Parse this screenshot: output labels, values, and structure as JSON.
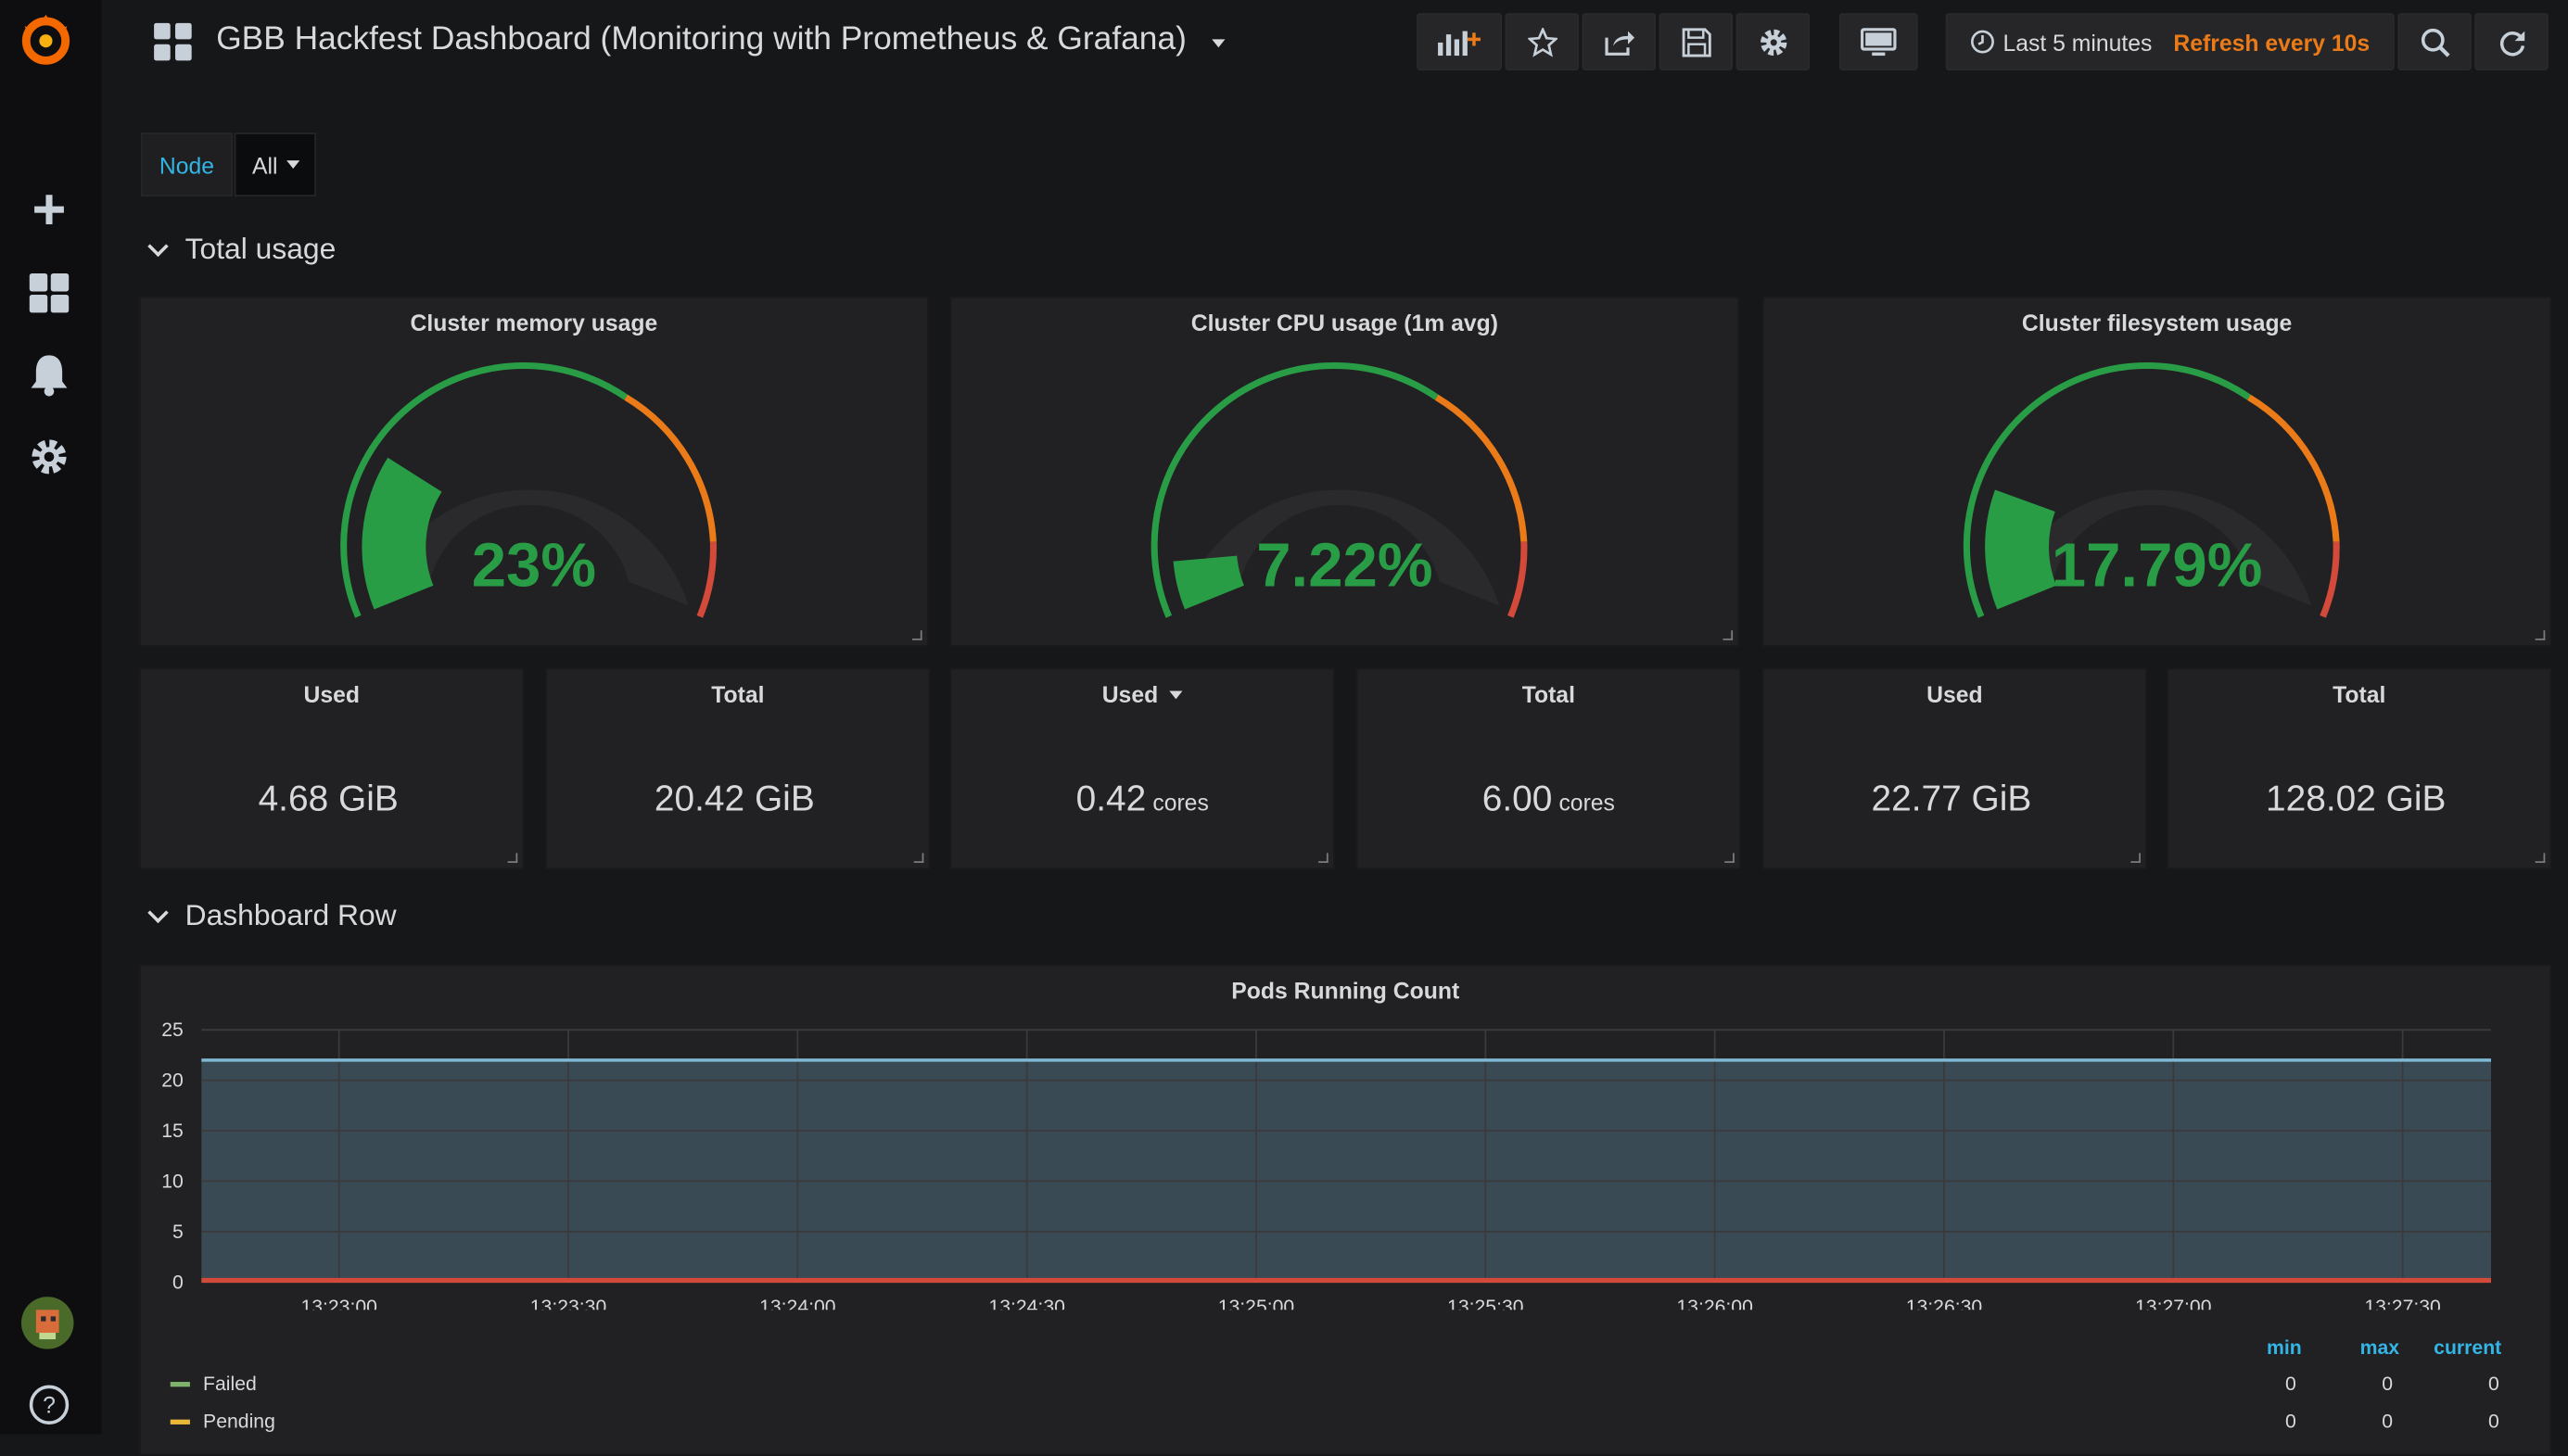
{
  "header": {
    "title": "GBB Hackfest Dashboard (Monitoring with Prometheus & Grafana)",
    "time_range": "Last 5 minutes",
    "refresh": "Refresh every 10s"
  },
  "sidebar": {
    "items": [
      "grafana-logo",
      "create",
      "dashboards",
      "alerting",
      "configuration",
      "profile",
      "help"
    ]
  },
  "variables": {
    "node_label": "Node",
    "node_value": "All"
  },
  "rows": {
    "total_usage": "Total usage",
    "dashboard_row": "Dashboard Row"
  },
  "gauges": [
    {
      "title": "Cluster memory usage",
      "value": "23%",
      "fraction": 0.23
    },
    {
      "title": "Cluster CPU usage (1m avg)",
      "value": "7.22%",
      "fraction": 0.0722
    },
    {
      "title": "Cluster filesystem usage",
      "value": "17.79%",
      "fraction": 0.1779
    }
  ],
  "stats": [
    {
      "title": "Used",
      "value": "4.68 GiB",
      "unit": ""
    },
    {
      "title": "Total",
      "value": "20.42 GiB",
      "unit": ""
    },
    {
      "title": "Used",
      "value": "0.42",
      "unit": "cores"
    },
    {
      "title": "Total",
      "value": "6.00",
      "unit": "cores"
    },
    {
      "title": "Used",
      "value": "22.77 GiB",
      "unit": ""
    },
    {
      "title": "Total",
      "value": "128.02 GiB",
      "unit": ""
    }
  ],
  "colors": {
    "ok": "#299c46",
    "warn": "#eb7b18",
    "crit": "#d44a3a",
    "running": "#7eb8d4",
    "failed": "#7eb26d",
    "pending": "#eab839",
    "accent": "#33b5e5"
  },
  "chart_data": {
    "type": "area",
    "title": "Pods Running Count",
    "x": [
      "13:23:00",
      "13:23:30",
      "13:24:00",
      "13:24:30",
      "13:25:00",
      "13:25:30",
      "13:26:00",
      "13:26:30",
      "13:27:00",
      "13:27:30"
    ],
    "yticks": [
      "0",
      "5",
      "10",
      "15",
      "20",
      "25"
    ],
    "ylim": [
      0,
      25
    ],
    "series": [
      {
        "name": "",
        "values": [
          22,
          22,
          22,
          22,
          22,
          22,
          22,
          22,
          22,
          22
        ],
        "color": "#7eb8d4"
      },
      {
        "name": "Failed",
        "values": [
          0,
          0,
          0,
          0,
          0,
          0,
          0,
          0,
          0,
          0
        ],
        "color": "#7eb26d"
      },
      {
        "name": "Pending",
        "values": [
          0,
          0,
          0,
          0,
          0,
          0,
          0,
          0,
          0,
          0
        ],
        "color": "#eab839"
      }
    ],
    "legend": {
      "columns": [
        "min",
        "max",
        "current"
      ],
      "rows": [
        {
          "name": "Failed",
          "min": "0",
          "max": "0",
          "current": "0"
        },
        {
          "name": "Pending",
          "min": "0",
          "max": "0",
          "current": "0"
        }
      ]
    }
  }
}
